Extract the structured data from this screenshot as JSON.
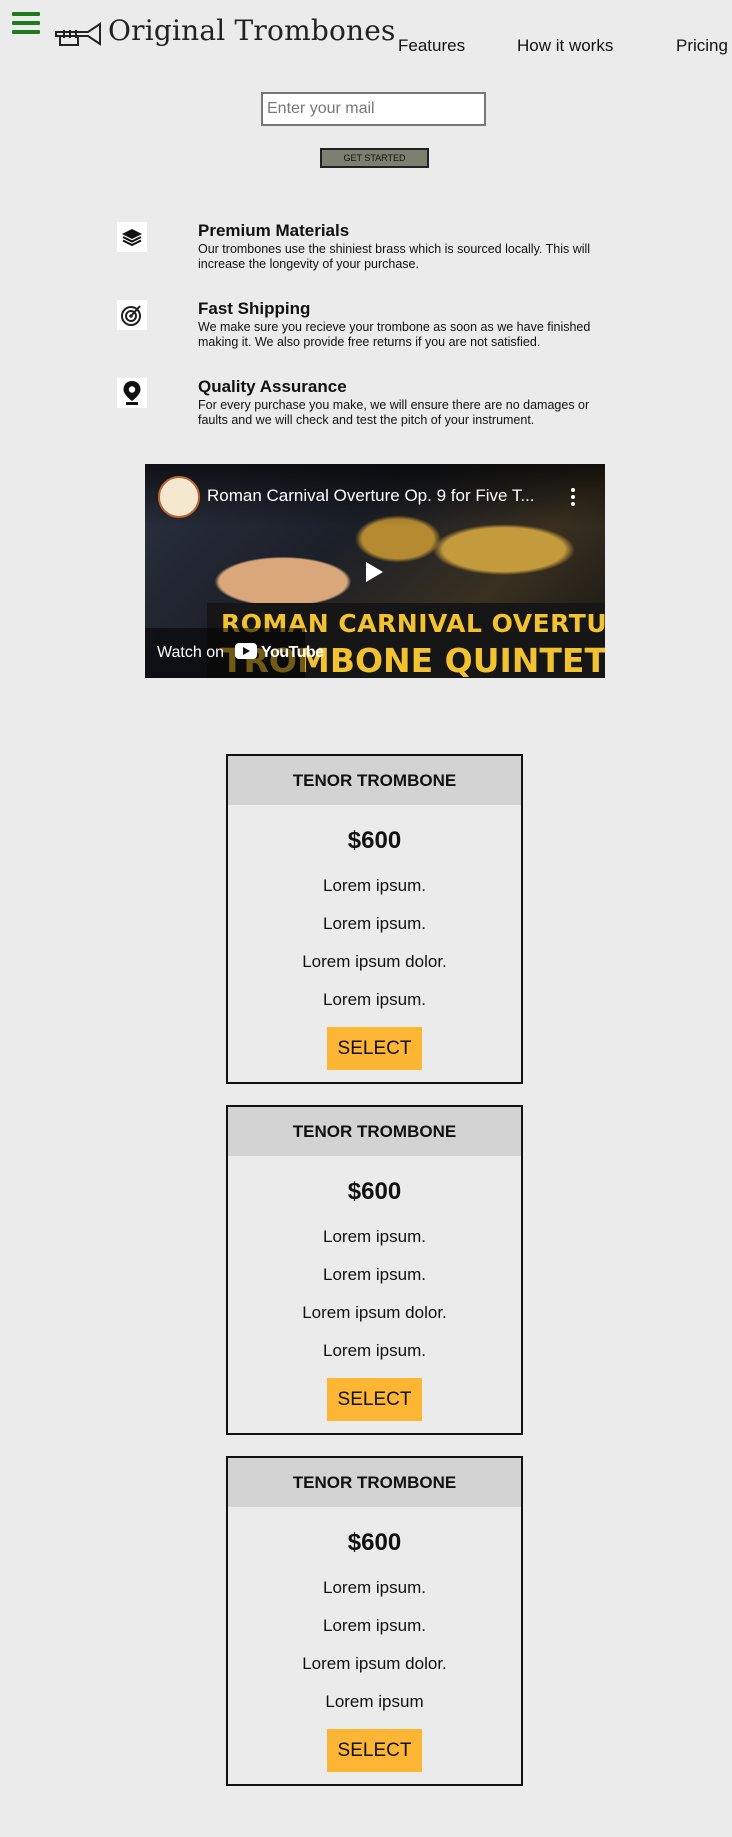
{
  "header": {
    "brand": "Original Trombones",
    "nav": [
      "Features",
      "How it works",
      "Pricing"
    ]
  },
  "hero": {
    "email_placeholder": "Enter your mail",
    "cta_label": "GET STARTED"
  },
  "features": [
    {
      "icon": "layers-icon",
      "title": "Premium Materials",
      "text": "Our trombones use the shiniest brass which is sourced locally. This will increase the longevity of your purchase."
    },
    {
      "icon": "target-icon",
      "title": "Fast Shipping",
      "text": "We make sure you recieve your trombone as soon as we have finished making it. We also provide free returns if you are not satisfied."
    },
    {
      "icon": "map-pin-icon",
      "title": "Quality Assurance",
      "text": "For every purchase you make, we will ensure there are no damages or faults and we will check and test the pitch of your instrument."
    }
  ],
  "video": {
    "title": "Roman Carnival Overture Op. 9 for Five T...",
    "banner_line1": "ROMAN CARNIVAL OVERTURE",
    "banner_line2": "TROMBONE QUINTET",
    "watch_on": "Watch on",
    "youtube": "YouTube"
  },
  "pricing": [
    {
      "name": "TENOR TROMBONE",
      "price": "$600",
      "features": [
        "Lorem ipsum.",
        "Lorem ipsum.",
        "Lorem ipsum dolor.",
        "Lorem ipsum."
      ],
      "button": "SELECT"
    },
    {
      "name": "TENOR TROMBONE",
      "price": "$600",
      "features": [
        "Lorem ipsum.",
        "Lorem ipsum.",
        "Lorem ipsum dolor.",
        "Lorem ipsum."
      ],
      "button": "SELECT"
    },
    {
      "name": "TENOR TROMBONE",
      "price": "$600",
      "features": [
        "Lorem ipsum.",
        "Lorem ipsum.",
        "Lorem ipsum dolor.",
        "Lorem ipsum"
      ],
      "button": "SELECT"
    }
  ],
  "colors": {
    "menu": "#1f7a1f",
    "select": "#fdb534",
    "cta": "#7b8070"
  }
}
